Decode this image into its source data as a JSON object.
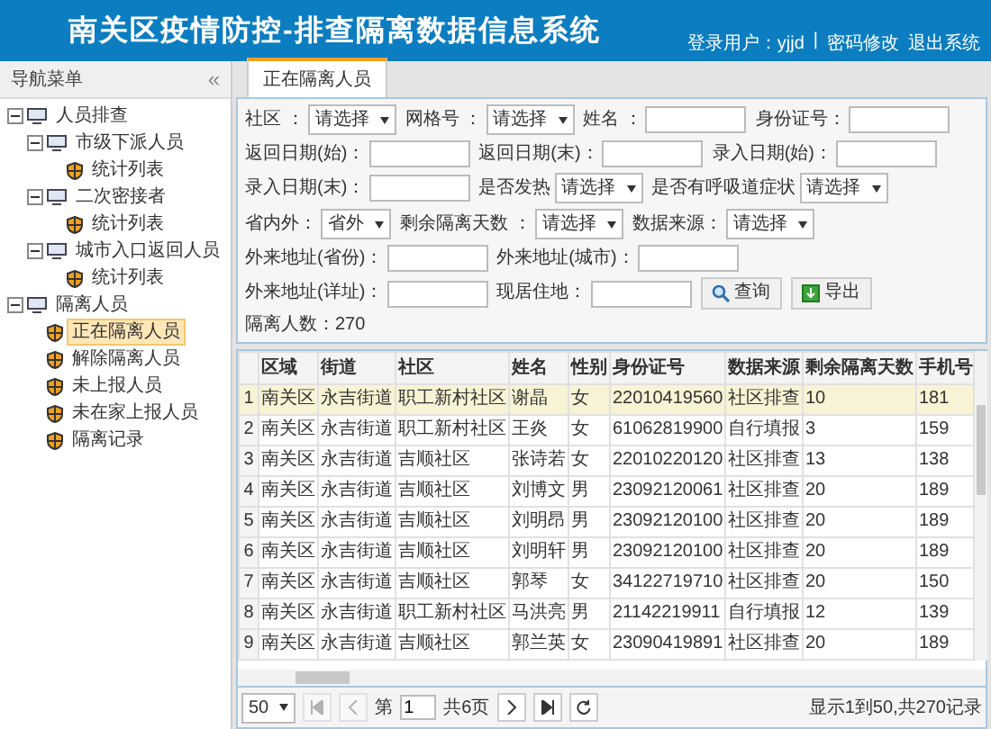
{
  "header": {
    "title": "南关区疫情防控-排查隔离数据信息系统",
    "user": "登录用户：yjjd",
    "separator": "|",
    "links": [
      "密码修改",
      "退出系统"
    ]
  },
  "sidebar": {
    "title": "导航菜单",
    "collapse": "«",
    "tree": [
      {
        "label": "人员排查",
        "kind": "group",
        "expanded": true,
        "selected": false,
        "children": [
          {
            "label": "市级下派人员",
            "kind": "group",
            "expanded": true,
            "selected": false,
            "children": [
              {
                "label": "统计列表",
                "kind": "page",
                "selected": false
              }
            ]
          },
          {
            "label": "二次密接者",
            "kind": "group",
            "expanded": true,
            "selected": false,
            "children": [
              {
                "label": "统计列表",
                "kind": "page",
                "selected": false
              }
            ]
          },
          {
            "label": "城市入口返回人员",
            "kind": "group",
            "expanded": true,
            "selected": false,
            "children": [
              {
                "label": "统计列表",
                "kind": "page",
                "selected": false
              }
            ]
          }
        ]
      },
      {
        "label": "隔离人员",
        "kind": "group",
        "expanded": true,
        "selected": false,
        "children": [
          {
            "label": "正在隔离人员",
            "kind": "page",
            "selected": true
          },
          {
            "label": "解除隔离人员",
            "kind": "page",
            "selected": false
          },
          {
            "label": "未上报人员",
            "kind": "page",
            "selected": false
          },
          {
            "label": "未在家上报人员",
            "kind": "page",
            "selected": false
          },
          {
            "label": "隔离记录",
            "kind": "page",
            "selected": false
          }
        ]
      }
    ]
  },
  "tabs": [
    {
      "label": "正在隔离人员",
      "selected": true
    }
  ],
  "filters": [
    {
      "kind": "select",
      "label": "社区 ：",
      "value": "请选择"
    },
    {
      "kind": "select",
      "label": "网格号 ：",
      "value": "请选择"
    },
    {
      "kind": "input",
      "label": "姓名 ："
    },
    {
      "kind": "input",
      "label": "身份证号："
    },
    {
      "kind": "input",
      "label": "返回日期(始)："
    },
    {
      "kind": "input",
      "label": "返回日期(末)："
    },
    {
      "kind": "input",
      "label": "录入日期(始)："
    },
    {
      "kind": "input",
      "label": "录入日期(末)："
    },
    {
      "kind": "select",
      "label": "是否发热",
      "value": "请选择"
    },
    {
      "kind": "select",
      "label": "是否有呼吸道症状",
      "value": "请选择"
    },
    {
      "kind": "select",
      "label": "省内外：",
      "value": "省外"
    },
    {
      "kind": "select",
      "label": "剩余隔离天数 ：",
      "value": "请选择"
    },
    {
      "kind": "select",
      "label": "数据来源：",
      "value": "请选择"
    },
    {
      "kind": "input",
      "label": "外来地址(省份)："
    },
    {
      "kind": "input",
      "label": "外来地址(城市)："
    },
    {
      "kind": "input",
      "label": "外来地址(详址)："
    },
    {
      "kind": "input",
      "label": "现居住地："
    }
  ],
  "actions": [
    {
      "kind": "search",
      "label": "查询"
    },
    {
      "kind": "export",
      "label": "导出"
    }
  ],
  "count": "隔离人数：270",
  "table": {
    "columns": [
      "",
      "区域",
      "街道",
      "社区",
      "姓名",
      "性别",
      "身份证号",
      "数据来源",
      "剩余隔离天数",
      "手机号"
    ],
    "rows": [
      {
        "selected": true,
        "cells": [
          "1",
          "南关区",
          "永吉街道",
          "职工新村社区",
          "谢晶",
          "女",
          "22010419560",
          "社区排查",
          "10",
          "181"
        ]
      },
      {
        "selected": false,
        "cells": [
          "2",
          "南关区",
          "永吉街道",
          "职工新村社区",
          "王炎",
          "女",
          "61062819900",
          "自行填报",
          "3",
          "159"
        ]
      },
      {
        "selected": false,
        "cells": [
          "3",
          "南关区",
          "永吉街道",
          "吉顺社区",
          "张诗若",
          "女",
          "22010220120",
          "社区排查",
          "13",
          "138"
        ]
      },
      {
        "selected": false,
        "cells": [
          "4",
          "南关区",
          "永吉街道",
          "吉顺社区",
          "刘博文",
          "男",
          "23092120061",
          "社区排查",
          "20",
          "189"
        ]
      },
      {
        "selected": false,
        "cells": [
          "5",
          "南关区",
          "永吉街道",
          "吉顺社区",
          "刘明昂",
          "男",
          "23092120100",
          "社区排查",
          "20",
          "189"
        ]
      },
      {
        "selected": false,
        "cells": [
          "6",
          "南关区",
          "永吉街道",
          "吉顺社区",
          "刘明轩",
          "男",
          "23092120100",
          "社区排查",
          "20",
          "189"
        ]
      },
      {
        "selected": false,
        "cells": [
          "7",
          "南关区",
          "永吉街道",
          "吉顺社区",
          "郭琴",
          "女",
          "34122719710",
          "社区排查",
          "20",
          "150"
        ]
      },
      {
        "selected": false,
        "cells": [
          "8",
          "南关区",
          "永吉街道",
          "职工新村社区",
          "马洪亮",
          "男",
          "21142219911",
          "自行填报",
          "12",
          "139"
        ]
      },
      {
        "selected": false,
        "cells": [
          "9",
          "南关区",
          "永吉街道",
          "吉顺社区",
          "郭兰英",
          "女",
          "23090419891",
          "社区排查",
          "20",
          "189"
        ]
      }
    ]
  },
  "pager": {
    "page_size": "50",
    "page_label": "第",
    "page": "1",
    "total_pages": "共6页",
    "summary": "显示1到50,共270记录"
  }
}
